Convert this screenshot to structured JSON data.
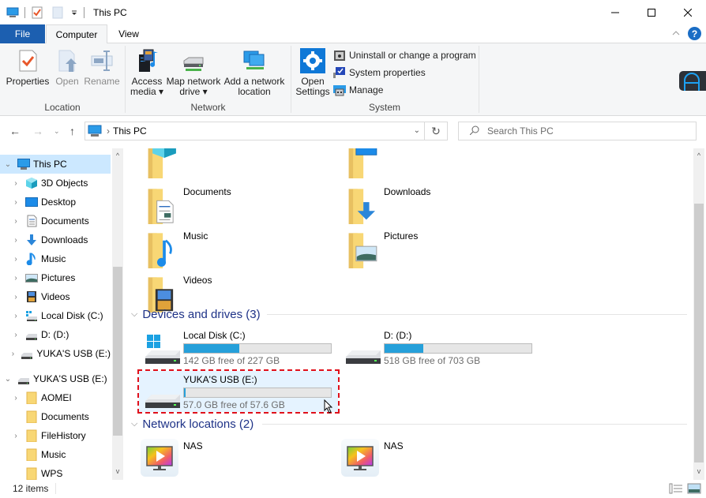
{
  "window": {
    "title": "This PC",
    "controls": {
      "minimize": "—",
      "maximize": "☐",
      "close": "✕"
    }
  },
  "quick_access": {
    "icons": [
      "computer-icon",
      "properties-icon",
      "new-folder-icon",
      "customize-dropdown-icon"
    ]
  },
  "ribbon": {
    "tabs": [
      {
        "label": "File",
        "active": false
      },
      {
        "label": "Computer",
        "active": true
      },
      {
        "label": "View",
        "active": false
      }
    ],
    "groups": {
      "location": {
        "label": "Location",
        "buttons": [
          {
            "label": "Properties",
            "enabled": true
          },
          {
            "label": "Open",
            "enabled": false
          },
          {
            "label": "Rename",
            "enabled": false
          }
        ]
      },
      "network": {
        "label": "Network",
        "buttons": [
          {
            "line1": "Access",
            "line2": "media ▾"
          },
          {
            "line1": "Map network",
            "line2": "drive ▾"
          },
          {
            "line1": "Add a network",
            "line2": "location"
          }
        ]
      },
      "system": {
        "label": "System",
        "open_settings": {
          "line1": "Open",
          "line2": "Settings"
        },
        "small_buttons": [
          {
            "label": "Uninstall or change a program"
          },
          {
            "label": "System properties"
          },
          {
            "label": "Manage"
          }
        ]
      }
    },
    "collapse_glyph": "^",
    "help_glyph": "?"
  },
  "navigation": {
    "back": "←",
    "forward": "→",
    "recent": "⌄",
    "up": "↑",
    "breadcrumb": [
      "This PC"
    ],
    "breadcrumb_sep": "›",
    "dropdown": "⌄",
    "refresh": "↻",
    "search_placeholder": "Search This PC"
  },
  "nav_pane": {
    "items": [
      {
        "label": "This PC",
        "chevron": "⌄",
        "level": 0,
        "selected": true,
        "icon": "computer-icon"
      },
      {
        "label": "3D Objects",
        "chevron": "›",
        "level": 1,
        "icon": "3d-objects-icon"
      },
      {
        "label": "Desktop",
        "chevron": "›",
        "level": 1,
        "icon": "desktop-icon"
      },
      {
        "label": "Documents",
        "chevron": "›",
        "level": 1,
        "icon": "documents-icon"
      },
      {
        "label": "Downloads",
        "chevron": "›",
        "level": 1,
        "icon": "downloads-icon"
      },
      {
        "label": "Music",
        "chevron": "›",
        "level": 1,
        "icon": "music-icon"
      },
      {
        "label": "Pictures",
        "chevron": "›",
        "level": 1,
        "icon": "pictures-icon"
      },
      {
        "label": "Videos",
        "chevron": "›",
        "level": 1,
        "icon": "videos-icon"
      },
      {
        "label": "Local Disk (C:)",
        "chevron": "›",
        "level": 1,
        "icon": "windows-drive-icon"
      },
      {
        "label": "D: (D:)",
        "chevron": "›",
        "level": 1,
        "icon": "drive-icon"
      },
      {
        "label": "YUKA'S USB (E:)",
        "chevron": "›",
        "level": 1,
        "icon": "drive-icon"
      },
      {
        "label": "YUKA'S USB (E:)",
        "chevron": "⌄",
        "level": 0,
        "icon": "drive-icon"
      },
      {
        "label": "AOMEI",
        "chevron": "›",
        "level": 1,
        "icon": "folder-icon"
      },
      {
        "label": "Documents",
        "chevron": "",
        "level": 1,
        "icon": "folder-icon"
      },
      {
        "label": "FileHistory",
        "chevron": "›",
        "level": 1,
        "icon": "folder-icon"
      },
      {
        "label": "Music",
        "chevron": "",
        "level": 1,
        "icon": "folder-icon"
      },
      {
        "label": "WPS",
        "chevron": "",
        "level": 1,
        "icon": "folder-icon"
      }
    ],
    "scroll_up": "^",
    "scroll_down": "v"
  },
  "content": {
    "folders": [
      {
        "name": "",
        "icon": "3d-objects-folder-icon"
      },
      {
        "name": "",
        "icon": "desktop-folder-icon"
      },
      {
        "name": "Documents",
        "icon": "documents-folder-icon"
      },
      {
        "name": "Downloads",
        "icon": "downloads-folder-icon"
      },
      {
        "name": "Music",
        "icon": "music-folder-icon"
      },
      {
        "name": "Pictures",
        "icon": "pictures-folder-icon"
      },
      {
        "name": "Videos",
        "icon": "videos-folder-icon"
      }
    ],
    "devices_header": "Devices and drives (3)",
    "drives": [
      {
        "name": "Local Disk (C:)",
        "free": "142 GB free of 227 GB",
        "used_fraction": 0.374,
        "icon": "windows-drive-icon",
        "selected": false
      },
      {
        "name": "D: (D:)",
        "free": "518 GB free of 703 GB",
        "used_fraction": 0.263,
        "icon": "drive-icon",
        "selected": false
      },
      {
        "name": "YUKA'S USB (E:)",
        "free": "57.0 GB free of 57.6 GB",
        "used_fraction": 0.01,
        "icon": "drive-icon",
        "selected": true
      }
    ],
    "network_header": "Network locations (2)",
    "network_locations": [
      {
        "name": "NAS",
        "icon": "media-server-icon"
      },
      {
        "name": "NAS",
        "icon": "media-server-icon"
      }
    ]
  },
  "status_bar": {
    "item_count": "12 items",
    "views": [
      "details-view-icon",
      "large-icons-view-icon"
    ]
  },
  "colors": {
    "accent": "#1c5fb0",
    "selection": "#cce8ff",
    "drive_bar": "#26a0da",
    "highlight_dash": "#e0101b",
    "section_header": "#1e3287"
  }
}
